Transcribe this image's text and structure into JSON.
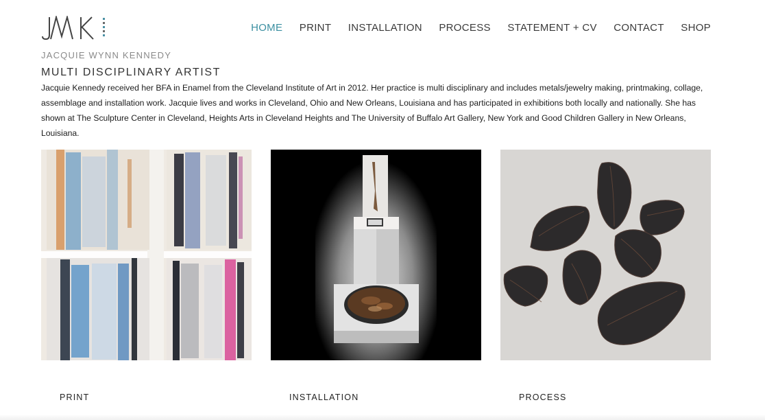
{
  "brand": {
    "logo_text": "JWK",
    "artist_name": "JACQUIE WYNN KENNEDY"
  },
  "nav": {
    "items": [
      {
        "label": "HOME",
        "active": true
      },
      {
        "label": "PRINT",
        "active": false
      },
      {
        "label": "INSTALLATION",
        "active": false
      },
      {
        "label": "PROCESS",
        "active": false
      },
      {
        "label": "STATEMENT + CV",
        "active": false
      },
      {
        "label": "CONTACT",
        "active": false
      },
      {
        "label": "SHOP",
        "active": false
      }
    ],
    "active_color": "#3b8fa1"
  },
  "intro": {
    "title": "MULTI DISCIPLINARY ARTIST",
    "bio": "Jacquie Kennedy received her BFA in Enamel from the Cleveland Institute of Art in 2012. Her practice is multi disciplinary and includes metals/jewelry making, printmaking, collage, assemblage and installation work. Jacquie lives and works in Cleveland, Ohio and New Orleans, Louisiana and has participated in exhibitions both locally and nationally. She has shown at The Sculpture Center in Cleveland, Heights Arts in Cleveland Heights and The University of Buffalo Art Gallery, New York and Good Children Gallery in New Orleans, Louisiana."
  },
  "gallery": {
    "tiles": [
      {
        "caption": "PRINT",
        "icon": "xray-print-image"
      },
      {
        "caption": "INSTALLATION",
        "icon": "pedestal-installation-image"
      },
      {
        "caption": "PROCESS",
        "icon": "metal-pods-image"
      }
    ]
  }
}
